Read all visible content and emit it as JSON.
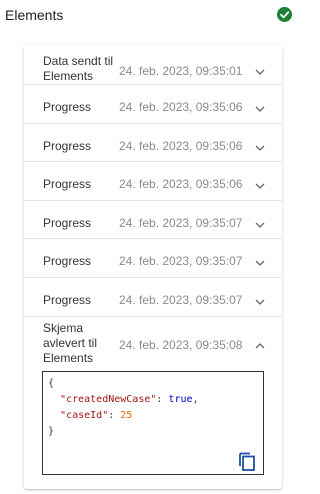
{
  "header": {
    "title": "Elements",
    "status_icon": "check-circle-icon",
    "status_color": "#1e7e34"
  },
  "events": [
    {
      "title": "Data sendt til Elements",
      "time": "24. feb. 2023, 09:35:01",
      "expanded": false
    },
    {
      "title": "Progress",
      "time": "24. feb. 2023, 09:35:06",
      "expanded": false
    },
    {
      "title": "Progress",
      "time": "24. feb. 2023, 09:35:06",
      "expanded": false
    },
    {
      "title": "Progress",
      "time": "24. feb. 2023, 09:35:06",
      "expanded": false
    },
    {
      "title": "Progress",
      "time": "24. feb. 2023, 09:35:07",
      "expanded": false
    },
    {
      "title": "Progress",
      "time": "24. feb. 2023, 09:35:07",
      "expanded": false
    },
    {
      "title": "Progress",
      "time": "24. feb. 2023, 09:35:07",
      "expanded": false
    },
    {
      "title": "Skjema avlevert til Elements",
      "time": "24. feb. 2023, 09:35:08",
      "expanded": true
    }
  ],
  "payload": {
    "open_brace": "{",
    "close_brace": "}",
    "entries": [
      {
        "key": "\"createdNewCase\"",
        "sep": ": ",
        "value": "true",
        "value_type": "bool",
        "trail": ","
      },
      {
        "key": "\"caseId\"",
        "sep": ": ",
        "value": "25",
        "value_type": "num",
        "trail": ""
      }
    ],
    "copy_icon": "copy-icon"
  }
}
